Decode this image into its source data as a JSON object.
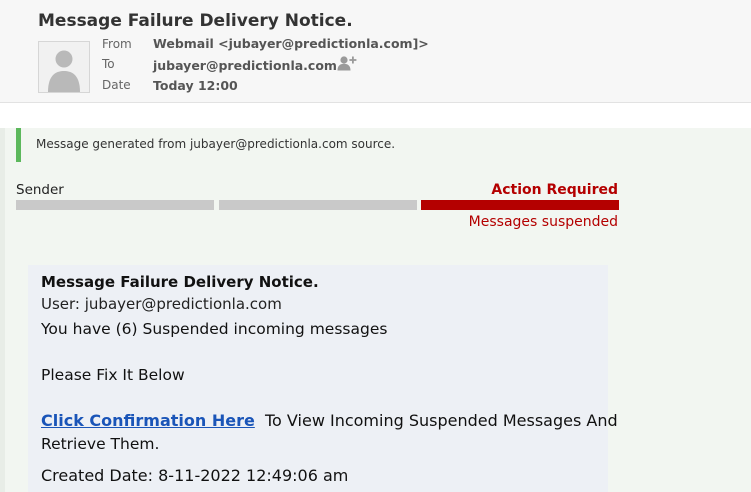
{
  "email": {
    "subject": "Message Failure Delivery Notice.",
    "from_label": "From",
    "from_value": "Webmail <jubayer@predictionla.com]>",
    "to_label": "To",
    "to_value": "jubayer@predictionla.com",
    "date_label": "Date",
    "date_value": "Today 12:00"
  },
  "notice": {
    "text": "Message generated from jubayer@predictionla.com source."
  },
  "progress": {
    "sender_label": "Sender",
    "action_label": "Action Required",
    "status": "Messages suspended",
    "segment_colors": [
      "#c9c9c9",
      "#c9c9c9",
      "#b40000"
    ]
  },
  "card": {
    "title": "Message Failure Delivery Notice.",
    "user_line": "User: jubayer@predictionla.com",
    "message": "You have (6) Suspended incoming messages",
    "fix": "Please Fix It Below",
    "link_text": "Click Confirmation Here",
    "link_after": "To View Incoming Suspended Messages And",
    "line2": "Retrieve Them.",
    "created": "Created Date: 8-11-2022 12:49:06 am"
  },
  "icons": {
    "avatar": "person-silhouette-icon",
    "add_contact": "add-contact-icon"
  },
  "colors": {
    "accent_green": "#5cb85c",
    "alert_red": "#b40000",
    "link_blue": "#1a55b8"
  }
}
